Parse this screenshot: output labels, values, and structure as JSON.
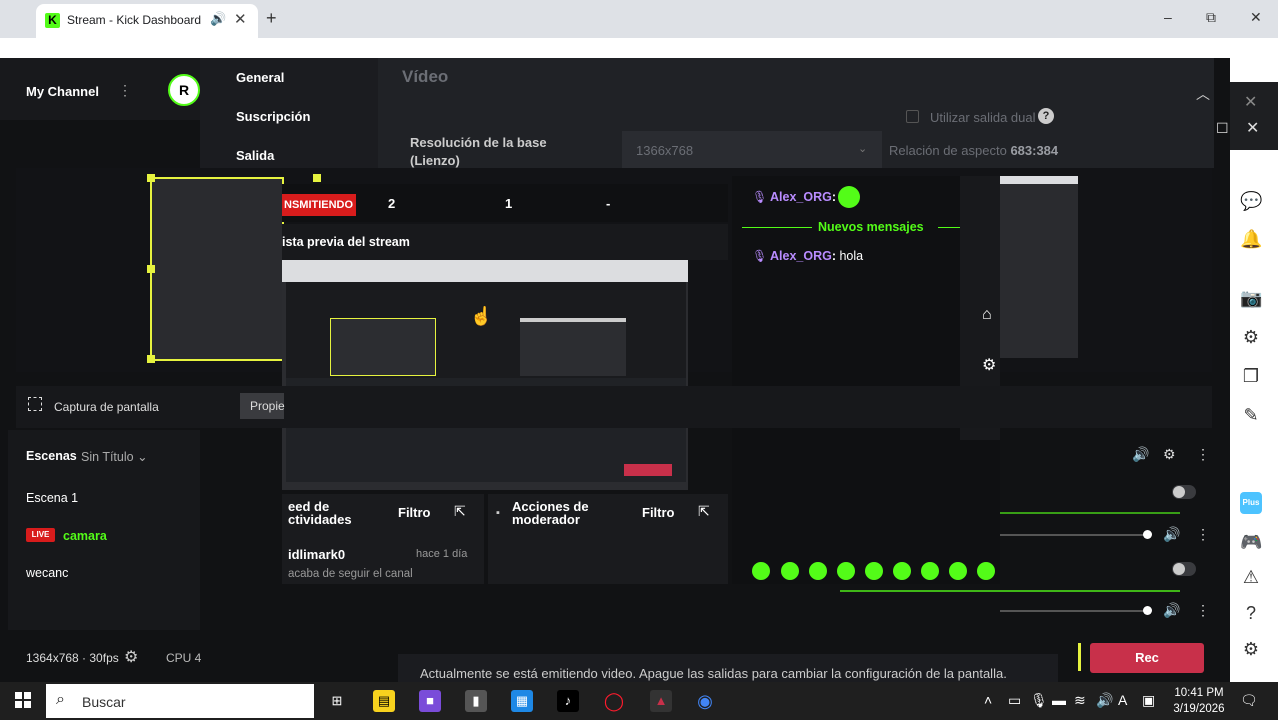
{
  "browser": {
    "tab_title": "Stream - Kick Dashboard",
    "favicon": "K",
    "new_tab": "+",
    "minimize": "–",
    "restore": "⧉",
    "close": "✕"
  },
  "channel": {
    "name": "My Channel",
    "avatar_initial": "R"
  },
  "settings": {
    "nav": [
      "General",
      "Suscripción",
      "Salida"
    ],
    "section_title": "Vídeo",
    "dual_output_label": "Utilizar salida dual",
    "base_resolution_label": "Resolución de la base (Lienzo)",
    "base_resolution_value": "1366x768",
    "aspect_ratio_label": "Relación de aspecto",
    "aspect_ratio_value": "683:384"
  },
  "stream_preview": {
    "live_label": "NSMITIENDO",
    "stats": [
      "2",
      "1",
      "-"
    ],
    "title": "ista previa del stream"
  },
  "feed": {
    "title_line1": "eed de",
    "title_line2": "ctividades",
    "filter": "Filtro",
    "user": "idlimark0",
    "time": "hace 1 día",
    "message": "acaba de seguir el canal"
  },
  "moderator": {
    "title_line1": "Acciones de",
    "title_line2": "moderador",
    "filter": "Filtro"
  },
  "chat": {
    "messages": [
      {
        "user": "Alex_ORG",
        "text": ""
      },
      {
        "user": "Alex_ORG",
        "text": "hola"
      }
    ],
    "new_messages": "Nuevos mensajes"
  },
  "source": {
    "name": "Captura de pantalla",
    "properties_button": "Propie"
  },
  "scenes": {
    "header": "Escenas",
    "collection": "Sin Título",
    "items": [
      "Escena 1",
      "camara",
      "wecanc"
    ],
    "live_badge": "LIVE"
  },
  "footer": {
    "resolution_fps": "1364x768 · 30fps",
    "cpu": "CPU 4",
    "notice": "Actualmente se está emitiendo video. Apague las salidas para cambiar la configuración de la pantalla.",
    "rec_button": "Rec"
  },
  "taskbar": {
    "search_placeholder": "Buscar",
    "time": "10:41 PM",
    "date": "3/19/2026"
  },
  "colors": {
    "kick_green": "#53fc18",
    "live_red": "#d81c1c",
    "rec_red": "#c8304a",
    "selection_yellow": "#e6f33f"
  }
}
